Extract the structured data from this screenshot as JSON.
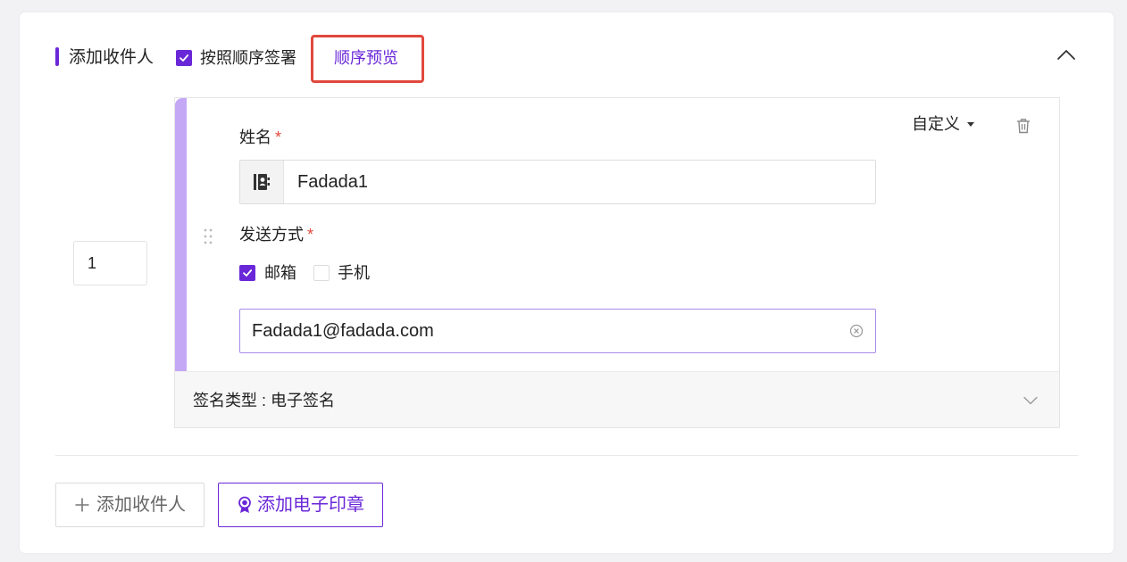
{
  "header": {
    "title": "添加收件人",
    "order_sign_checked": true,
    "order_sign_label": "按照顺序签署",
    "preview_link": "顺序预览"
  },
  "recipient": {
    "order_number": "1",
    "role_select": "自定义",
    "name_label": "姓名",
    "name_value": "Fadada1",
    "send_method_label": "发送方式",
    "required_mark": "*",
    "methods": [
      {
        "label": "邮箱",
        "checked": true
      },
      {
        "label": "手机",
        "checked": false
      }
    ],
    "email_value": "Fadada1@fadada.com",
    "sign_type": "签名类型 : 电子签名"
  },
  "footer": {
    "add_recipient": "添加收件人",
    "add_seal": "添加电子印章"
  },
  "colors": {
    "accent": "#6a27d8",
    "accent_light": "#c4a8f5",
    "highlight_border": "#e1483c"
  }
}
